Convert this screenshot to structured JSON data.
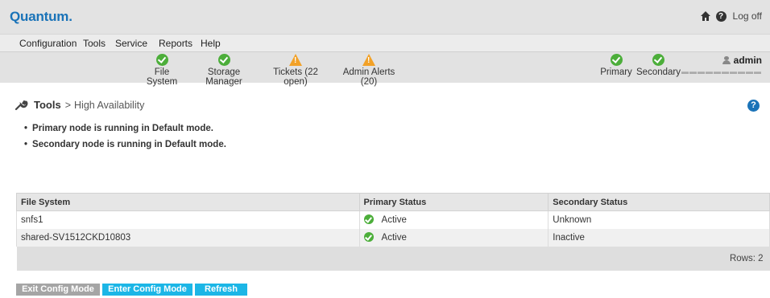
{
  "header": {
    "logo": "Quantum.",
    "logoff": "Log off",
    "home_icon": "home-icon",
    "help_icon": "help-icon"
  },
  "menu": {
    "items": [
      "Configuration",
      "Tools",
      "Service",
      "Reports",
      "Help"
    ]
  },
  "status": {
    "items": [
      {
        "label": "File System",
        "icon": "check-circle-icon",
        "color": "#4cae3a"
      },
      {
        "label": "Storage Manager",
        "icon": "check-circle-icon",
        "color": "#4cae3a"
      },
      {
        "label": "Tickets (22 open)",
        "icon": "warning-icon",
        "color": "#f2a127"
      },
      {
        "label": "Admin Alerts (20)",
        "icon": "warning-icon",
        "color": "#f2a127"
      },
      {
        "label": "Primary",
        "icon": "check-circle-icon",
        "color": "#4cae3a"
      },
      {
        "label": "Secondary",
        "icon": "check-circle-icon",
        "color": "#4cae3a"
      }
    ],
    "user": "admin"
  },
  "breadcrumb": {
    "section": "Tools",
    "separator": ">",
    "page": "High Availability"
  },
  "messages": [
    "Primary node is running in Default mode.",
    "Secondary node is running in Default mode."
  ],
  "table": {
    "columns": [
      "File System",
      "Primary Status",
      "Secondary Status"
    ],
    "rows": [
      {
        "fs": "snfs1",
        "primary": "Active",
        "secondary": "Unknown"
      },
      {
        "fs": "shared-SV1512CKD10803",
        "primary": "Active",
        "secondary": "Inactive"
      }
    ],
    "rows_label": "Rows: 2"
  },
  "buttons": {
    "exit": "Exit Config Mode",
    "enter": "Enter Config Mode",
    "refresh": "Refresh"
  },
  "colors": {
    "brand": "#1a73b8",
    "ok": "#4cae3a",
    "warn": "#f2a127",
    "accent_button": "#1cb6e6"
  }
}
